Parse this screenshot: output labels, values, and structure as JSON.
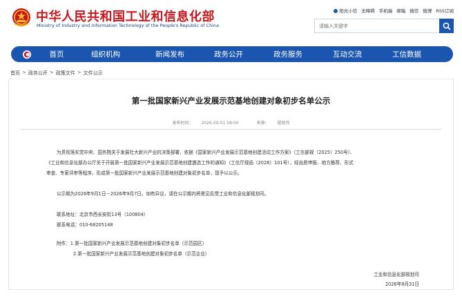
{
  "header": {
    "site_title": "中华人民共和国工业和信息化部",
    "site_subtitle": "Ministry of Industry and Information Technology of the People's Republic of China",
    "toplinks": [
      "阳光小信",
      "无障碍",
      "手机端",
      "邮箱",
      "微信",
      "微博",
      "RSS订阅"
    ],
    "search_placeholder": "请输入关键字"
  },
  "nav": {
    "items": [
      "首页",
      "组织机构",
      "新闻发布",
      "政务公开",
      "政务服务",
      "互动交流",
      "工信数据"
    ]
  },
  "breadcrumb": [
    "首页",
    "政务公开",
    "政策文件",
    "文件公示"
  ],
  "article": {
    "title": "第一批国家新兴产业发展示范基地创建对象初步名单公示",
    "publish_label": "发布时间：",
    "publish_time": "2026-09-01 08:00",
    "source_label": "来源：",
    "source": "规划司",
    "para1_line1": "为贯彻落实党中央、国务院关于发展壮大新兴产业的决策部署，依据《国家新兴产业发展示范基地创建活动工作方案》（工信部规〔2025〕250号）、",
    "para1_line2": "《工业和信息化部办公厅关于开展第一批国家新兴产业发展示范基地创建遴选工作的通知》（工信厅规函〔2026〕101号），经自愿申报、地方推荐、形式",
    "para1_line3": "审查、专家评审等程序，形成第一批国家新兴产业发展示范基地创建对象初步名单，现予以公示。",
    "para2": "公示期为2026年9月1日－2026年9月7日。如有异议，请在公示期内将意见反馈工业和信息化部规划司。",
    "contact_address": "联系地址：北京市西长安街13号（100804）",
    "contact_phone": "联系电话：010-68205148",
    "attachment1": "附件：1.第一批国家新兴产业发展示范基地创建对象初步名单（示范园区）",
    "attachment2": "2.第一批国家新兴产业发展示范基地创建对象初步名单（示范企业）",
    "signer": "工业和信息化部规划司",
    "sign_date": "2026年8月31日"
  },
  "colors": {
    "brand_red": "#c8161d",
    "brand_blue": "#1a56b0"
  }
}
